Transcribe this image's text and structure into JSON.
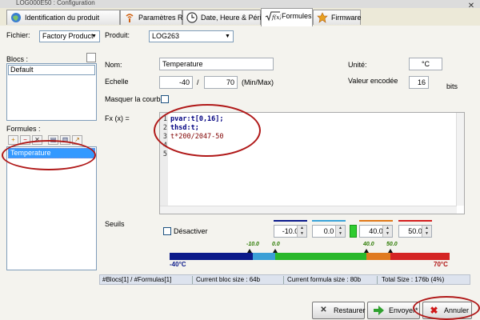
{
  "window": {
    "title": "LOG000E50 : Configuration"
  },
  "tabs": [
    {
      "label": "Identification du produit",
      "icon": "globe-icon"
    },
    {
      "label": "Paramètres RF",
      "icon": "antenna-icon"
    },
    {
      "label": "Date, Heure & Périodes",
      "icon": "clock-icon"
    },
    {
      "label": "Formules",
      "icon": "sqrt-fx-icon",
      "active": true
    },
    {
      "label": "Firmware",
      "icon": "star-icon"
    }
  ],
  "close_glyph": "✕",
  "fichier": {
    "label": "Fichier:",
    "value": "Factory Product"
  },
  "produit": {
    "label": "Produit:",
    "value": "LOG263"
  },
  "blocs": {
    "label": "Blocs :",
    "items": [
      "Default"
    ]
  },
  "formules": {
    "label": "Formules :",
    "items": [
      "Temperature"
    ]
  },
  "form": {
    "nom_label": "Nom:",
    "nom_value": "Temperature",
    "unite_label": "Unité:",
    "unite_value": "°C",
    "echelle_label": "Echelle",
    "echelle_min": "-40",
    "echelle_sep": "/",
    "echelle_max": "70",
    "minmax_label": "(Min/Max)",
    "valeur_label": "Valeur encodée",
    "valeur_value": "16",
    "bits_label": "bits",
    "masquer_label": "Masquer la courbe",
    "fx_label": "Fx (x) ="
  },
  "code": {
    "lines": [
      "1",
      "2",
      "3",
      "4",
      "5"
    ],
    "content": [
      "pvar:t[0,16];",
      "thsd:t;",
      "t*200/2047-50",
      "",
      ""
    ]
  },
  "seuils": {
    "label": "Seuils",
    "desactiver_label": "Désactiver",
    "values": [
      "-10.0",
      "0.0",
      "40.0",
      "50.0"
    ],
    "colors": [
      "#0a1a8c",
      "#3aa3d8",
      "#e07818",
      "#d41e1e"
    ],
    "ticks": [
      "-10.0",
      "0.0",
      "40.0",
      "50.0"
    ],
    "min_label": "-40°C",
    "max_label": "70°C"
  },
  "status": {
    "blocs": "#Blocs[1] / #Formulas[1]",
    "bloc_size": "Current bloc size : 64b",
    "formula_size": "Current formula size : 80b",
    "total": "Total Size : 176b (4%)"
  },
  "buttons": {
    "restaurer": "Restaurer",
    "envoyer": "Envoyer*",
    "annuler": "Annuler"
  }
}
